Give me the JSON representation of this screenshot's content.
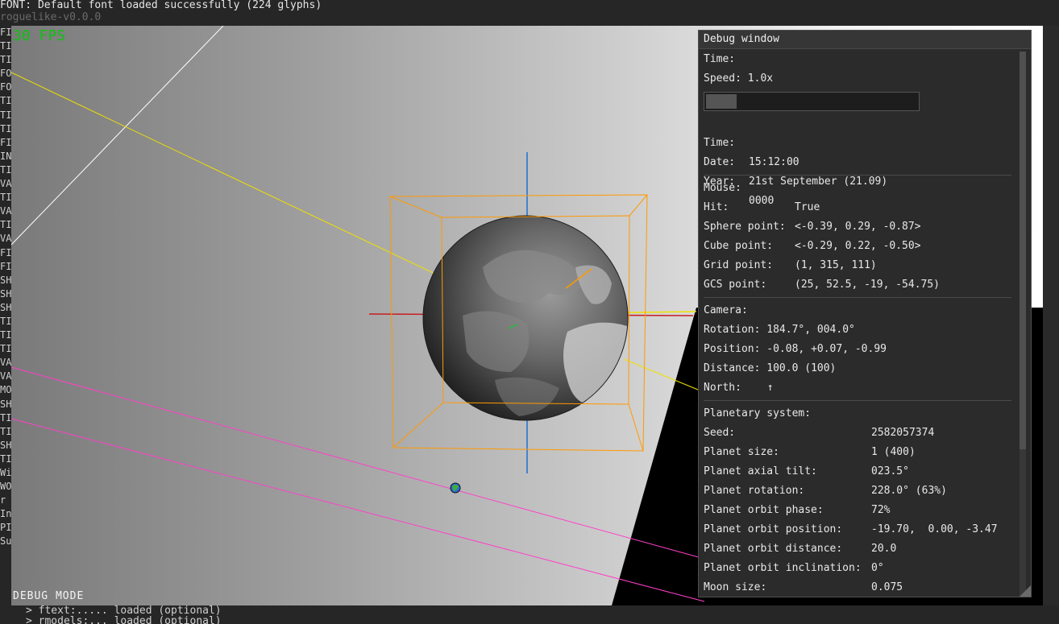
{
  "console": {
    "top_line": "FONT: Default font loaded successfully (224 glyphs)",
    "second_line": "roguelike-v0.0.0",
    "left_lines": [
      "FI",
      "TI",
      "TI",
      "FO",
      "FO",
      "TI",
      "TI",
      "TI",
      "FI",
      "IN",
      "TI",
      "VA",
      "TI",
      "VA",
      "TI",
      "VA",
      "FI",
      "FI",
      "SH",
      "SH",
      "SH",
      "TI",
      "TI",
      "TI",
      "VA",
      "VA",
      "MO",
      "SH",
      "TI",
      "TI",
      "SH",
      "TI",
      "Wi",
      "WO",
      "r",
      "In",
      "PI",
      "Su"
    ],
    "bottom_lines": [
      "> ftext:..... loaded (optional)",
      "> rmodels:... loaded (optional)"
    ]
  },
  "viewport": {
    "fps": "30 FPS",
    "debug_mode": "DEBUG MODE"
  },
  "colors": {
    "fps": "#10c010",
    "orange_box": "#ff9900",
    "axis_blue": "#1e6fd0",
    "axis_red": "#c81e1e",
    "line_yellow": "#f0e000",
    "line_pink": "#ff40c8"
  },
  "debug_window": {
    "title": "Debug window",
    "time_section": {
      "header": "Time:",
      "speed": "Speed: 1.0x",
      "speed_slider_value": 0.15,
      "time_label": "Time:",
      "time_value": "15:12:00",
      "date_label": "Date:",
      "date_value": "21st September (21.09)",
      "year_label": "Year:",
      "year_value": "0000"
    },
    "mouse_section": {
      "header": "Mouse:",
      "rows": [
        {
          "label": "Hit:",
          "value": "True"
        },
        {
          "label": "Sphere point:",
          "value": "<-0.39, 0.29, -0.87>"
        },
        {
          "label": "Cube point:",
          "value": "<-0.29, 0.22, -0.50>"
        },
        {
          "label": "Grid point:",
          "value": "(1, 315, 111)"
        },
        {
          "label": "GCS point:",
          "value": "(25, 52.5, -19, -54.75)"
        }
      ]
    },
    "camera_section": {
      "header": "Camera:",
      "rows": [
        {
          "label": "Rotation:",
          "value": "184.7°, 004.0°"
        },
        {
          "label": "Position:",
          "value": "-0.08, +0.07, -0.99"
        },
        {
          "label": "Distance:",
          "value": "100.0 (100)"
        },
        {
          "label": "North:",
          "value": "↑"
        }
      ]
    },
    "planetary_section": {
      "header": "Planetary system:",
      "rows": [
        {
          "label": "Seed:",
          "value": "2582057374"
        },
        {
          "label": "Planet size:",
          "value": "1 (400)"
        },
        {
          "label": "Planet axial tilt:",
          "value": "023.5°"
        },
        {
          "label": "Planet rotation:",
          "value": "228.0° (63%)"
        },
        {
          "label": "Planet orbit phase:",
          "value": "72%"
        },
        {
          "label": "Planet orbit position:",
          "value": "-19.70,  0.00, -3.47"
        },
        {
          "label": "Planet orbit distance:",
          "value": "20.0"
        },
        {
          "label": "Planet orbit inclination:",
          "value": "0°"
        },
        {
          "label": "Moon size:",
          "value": "0.075"
        }
      ]
    }
  }
}
